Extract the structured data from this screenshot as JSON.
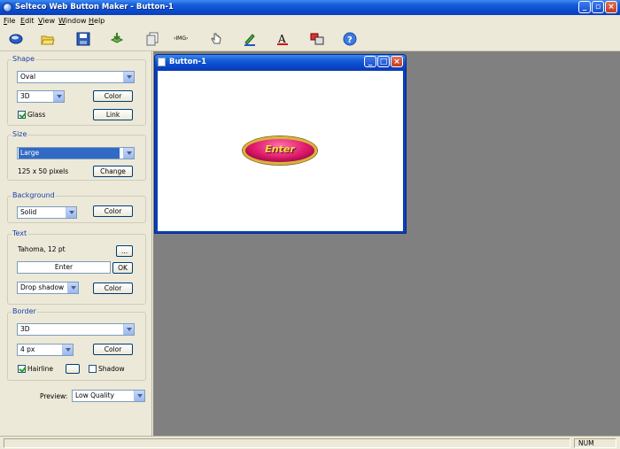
{
  "window": {
    "title": "Selteco Web Button Maker - Button-1"
  },
  "menu": [
    {
      "label": "File",
      "accel": "F",
      "rest": "ile"
    },
    {
      "label": "Edit",
      "accel": "E",
      "rest": "dit"
    },
    {
      "label": "View",
      "accel": "V",
      "rest": "iew"
    },
    {
      "label": "Window",
      "accel": "W",
      "rest": "indow"
    },
    {
      "label": "Help",
      "accel": "H",
      "rest": "elp"
    }
  ],
  "toolbar": {
    "icons": [
      "new-button-icon",
      "open-icon",
      "save-icon",
      "export-icon",
      "copy-icon",
      "html-icon",
      "hand-icon",
      "pen-icon",
      "text-color-icon",
      "image-icon",
      "help-icon"
    ],
    "html_label": "‹IMG›"
  },
  "shape": {
    "title": "Shape",
    "type": "Oval",
    "style": "3D",
    "color_label": "Color",
    "glass_label": "Glass",
    "glass_checked": true,
    "link_label": "Link"
  },
  "size": {
    "title": "Size",
    "value": "Large",
    "dimensions": "125 x 50 pixels",
    "change_label": "Change"
  },
  "background": {
    "title": "Background",
    "value": "Solid",
    "color_label": "Color"
  },
  "text": {
    "title": "Text",
    "font": "Tahoma, 12 pt",
    "font_btn_label": "...",
    "value": "Enter",
    "ok_label": "OK",
    "effect": "Drop shadow",
    "color_label": "Color"
  },
  "border": {
    "title": "Border",
    "type": "3D",
    "width": "4 px",
    "color_label": "Color",
    "hairline_label": "Hairline",
    "hairline_checked": true,
    "shadow_label": "Shadow",
    "shadow_checked": false
  },
  "preview": {
    "label": "Preview:",
    "quality": "Low Quality"
  },
  "document": {
    "title": "Button-1",
    "button_text": "Enter"
  },
  "status": {
    "num": "NUM"
  },
  "colors": {
    "button_fill": "#e0186a",
    "button_border": "#d9b23c",
    "button_text": "#f5e23a"
  }
}
